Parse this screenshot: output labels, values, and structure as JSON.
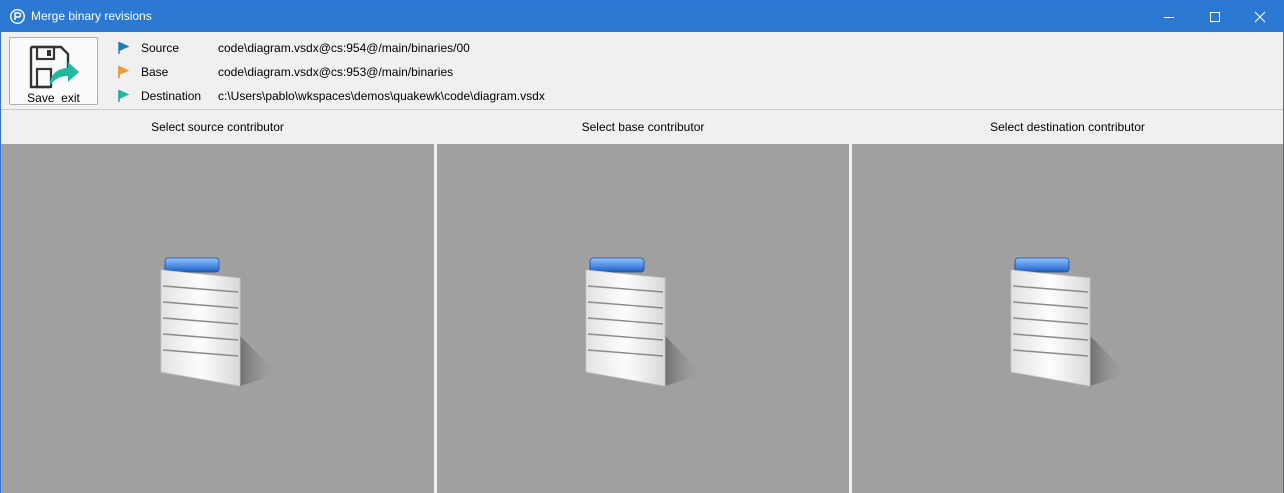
{
  "window": {
    "title": "Merge binary revisions",
    "accent_color": "#2b79d3",
    "controls": {
      "minimize_icon": "minimize-icon",
      "maximize_icon": "maximize-icon",
      "close_icon": "close-icon"
    }
  },
  "toolbar": {
    "save_label": "Save  exit",
    "save_icon": "save-exit-icon"
  },
  "revisions": {
    "source": {
      "label": "Source",
      "value": "code\\diagram.vsdx@cs:954@/main/binaries/00",
      "flag_color": "#1f7ab8"
    },
    "base": {
      "label": "Base",
      "value": "code\\diagram.vsdx@cs:953@/main/binaries",
      "flag_color": "#e08a1e"
    },
    "destination": {
      "label": "Destination",
      "value": "c:\\Users\\pablo\\wkspaces\\demos\\quakewk\\code\\diagram.vsdx",
      "flag_color": "#1a9e8a"
    }
  },
  "panels": {
    "source": {
      "header": "Select source contributor",
      "icon": "document-placeholder-icon"
    },
    "base": {
      "header": "Select base contributor",
      "icon": "document-placeholder-icon"
    },
    "destination": {
      "header": "Select destination contributor",
      "icon": "document-placeholder-icon"
    }
  }
}
